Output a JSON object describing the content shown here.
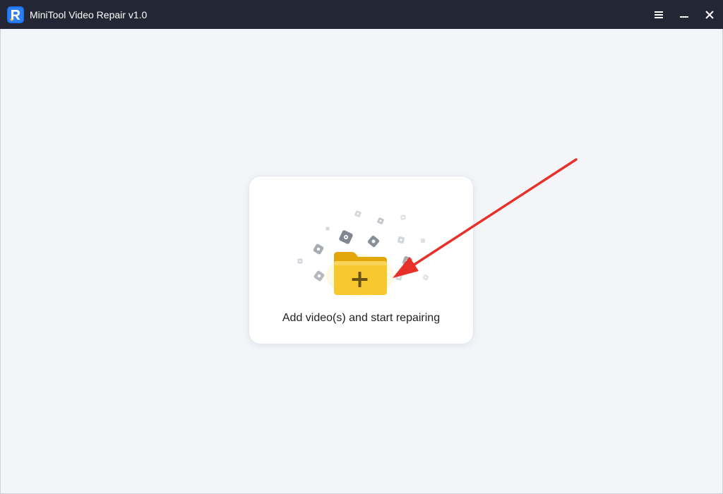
{
  "titlebar": {
    "title": "MiniTool Video Repair v1.0",
    "logo_icon": "minitool-r-logo-icon",
    "background": "#232634",
    "controls": [
      "menu-icon",
      "minimize-icon",
      "close-icon"
    ]
  },
  "main": {
    "background": "#f3f5f8",
    "card": {
      "label": "Add video(s) and start repairing",
      "icon": "folder-add-icon",
      "folder_color": "#f8c92f"
    }
  },
  "annotation": {
    "arrow_color": "#e8302a",
    "icon": "red-arrow-annotation"
  }
}
